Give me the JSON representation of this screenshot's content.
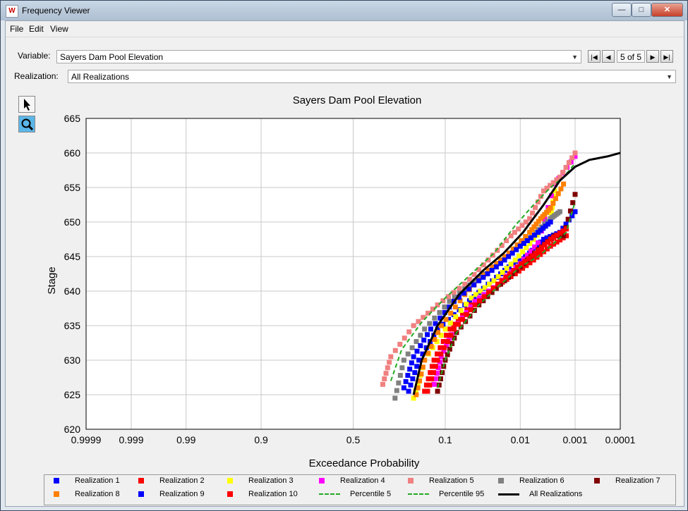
{
  "window": {
    "title": "Frequency Viewer",
    "minimize": "—",
    "maximize": "□",
    "close": "✕"
  },
  "menu": {
    "items": [
      "File",
      "Edit",
      "View"
    ]
  },
  "controls": {
    "variable_label": "Variable:",
    "variable_value": "Sayers Dam Pool Elevation",
    "realization_label": "Realization:",
    "realization_value": "All Realizations",
    "nav_count": "5 of 5"
  },
  "icons": {
    "first": "first-icon",
    "prev": "prev-icon",
    "next": "next-icon",
    "last": "last-icon",
    "pointer": "pointer-icon",
    "zoom": "zoom-icon"
  },
  "chart_data": {
    "type": "scatter",
    "title": "Sayers Dam Pool Elevation",
    "xlabel": "Exceedance Probability",
    "ylabel": "Stage",
    "x_scale": "normal-probability (reversed)",
    "x_ticks": [
      "0.9999",
      "0.999",
      "0.99",
      "0.9",
      "0.5",
      "0.1",
      "0.01",
      "0.001",
      "0.0001"
    ],
    "x_tick_values": [
      0.9999,
      0.999,
      0.99,
      0.9,
      0.5,
      0.1,
      0.01,
      0.001,
      0.0001
    ],
    "ylim": [
      620,
      665
    ],
    "y_ticks": [
      620,
      625,
      630,
      635,
      640,
      645,
      650,
      655,
      660,
      665
    ],
    "grid": true,
    "legend_position": "bottom",
    "series": [
      {
        "name": "Realization 1",
        "color": "#0000ff",
        "kind": "square",
        "x": [
          0.22,
          0.18,
          0.12,
          0.06,
          0.03,
          0.015,
          0.007,
          0.004,
          0.002,
          0.001
        ],
        "y": [
          625.5,
          630,
          634.5,
          638,
          641,
          643.5,
          645.5,
          647.5,
          648.5,
          651.5
        ]
      },
      {
        "name": "Realization 2",
        "color": "#ff0000",
        "kind": "square",
        "x": [
          0.16,
          0.13,
          0.09,
          0.05,
          0.025,
          0.012,
          0.006,
          0.003,
          0.0015
        ],
        "y": [
          625.5,
          630,
          634.5,
          638,
          640.5,
          642.5,
          644.5,
          646.5,
          648
        ]
      },
      {
        "name": "Realization 3",
        "color": "#ffff00",
        "kind": "square",
        "x": [
          0.2,
          0.16,
          0.1,
          0.05,
          0.025,
          0.012,
          0.006,
          0.003,
          0.0025
        ],
        "y": [
          624.5,
          630,
          634.5,
          639,
          641.5,
          644.5,
          647.5,
          650.5,
          654.5
        ]
      },
      {
        "name": "Realization 4",
        "color": "#ff00ff",
        "kind": "square",
        "x": [
          0.13,
          0.11,
          0.08,
          0.045,
          0.022,
          0.01,
          0.005,
          0.0025,
          0.001
        ],
        "y": [
          626.5,
          630.5,
          634.5,
          638.5,
          641,
          644,
          647,
          655.5,
          659.5
        ]
      },
      {
        "name": "Realization 5",
        "color": "#f08080",
        "kind": "square",
        "x": [
          0.34,
          0.3,
          0.2,
          0.12,
          0.06,
          0.03,
          0.014,
          0.007,
          0.004,
          0.002,
          0.001
        ],
        "y": [
          626.5,
          630.5,
          635,
          638,
          641,
          644.5,
          648,
          650.5,
          654.5,
          656.5,
          660
        ]
      },
      {
        "name": "Realization 6",
        "color": "#808080",
        "kind": "square",
        "x": [
          0.28,
          0.24,
          0.16,
          0.09,
          0.045,
          0.022,
          0.011,
          0.0055,
          0.003,
          0.002
        ],
        "y": [
          624.5,
          630,
          634.5,
          638.5,
          641.5,
          644,
          646.5,
          648.5,
          650.5,
          651.5
        ]
      },
      {
        "name": "Realization 7",
        "color": "#800000",
        "kind": "square",
        "x": [
          0.12,
          0.1,
          0.075,
          0.04,
          0.02,
          0.01,
          0.005,
          0.0025,
          0.0017,
          0.001
        ],
        "y": [
          625.5,
          630,
          634,
          638,
          641,
          643.5,
          646,
          648,
          648,
          654
        ]
      },
      {
        "name": "Realization 8",
        "color": "#ff8000",
        "kind": "square",
        "x": [
          0.19,
          0.16,
          0.11,
          0.06,
          0.03,
          0.015,
          0.007,
          0.0045,
          0.003,
          0.0017
        ],
        "y": [
          625,
          630,
          635,
          639.5,
          643,
          645.5,
          648.5,
          650.5,
          652,
          655.5
        ]
      },
      {
        "name": "Realization 9",
        "color": "#0000ff",
        "kind": "square",
        "x": [
          0.24,
          0.2,
          0.14,
          0.08,
          0.04,
          0.02,
          0.01,
          0.005,
          0.003
        ],
        "y": [
          626,
          630.5,
          634.5,
          638.5,
          641.5,
          644,
          646.5,
          648.5,
          650
        ]
      },
      {
        "name": "Realization 10",
        "color": "#ff0000",
        "kind": "square",
        "x": [
          0.15,
          0.12,
          0.08,
          0.045,
          0.022,
          0.011,
          0.0055,
          0.003,
          0.0015
        ],
        "y": [
          625.5,
          630,
          634.5,
          638,
          641,
          643.5,
          645.5,
          647.5,
          649
        ]
      },
      {
        "name": "Percentile 5",
        "color": "#22aa22",
        "kind": "dashed",
        "x": [
          0.3,
          0.25,
          0.17,
          0.1,
          0.05,
          0.025,
          0.012,
          0.006,
          0.003,
          0.0017,
          0.001
        ],
        "y": [
          627,
          631.5,
          635.5,
          639,
          642.5,
          645.5,
          649.5,
          652.5,
          655,
          656.5,
          658.5
        ]
      },
      {
        "name": "Percentile 95",
        "color": "#22aa22",
        "kind": "dashed",
        "x": [
          0.12,
          0.1,
          0.075,
          0.04,
          0.02,
          0.01,
          0.005,
          0.003,
          0.0015,
          0.001
        ],
        "y": [
          626,
          630,
          634,
          638,
          641,
          643.5,
          645,
          646.5,
          648.5,
          653
        ]
      },
      {
        "name": "All Realizations",
        "color": "#000000",
        "kind": "solid",
        "x": [
          0.2,
          0.17,
          0.12,
          0.07,
          0.035,
          0.018,
          0.009,
          0.004,
          0.002,
          0.001,
          0.0005,
          0.0002,
          0.0001
        ],
        "y": [
          625,
          630,
          635,
          639.5,
          643,
          645.5,
          648.5,
          652.5,
          656,
          658,
          659,
          659.5,
          660
        ]
      }
    ]
  }
}
